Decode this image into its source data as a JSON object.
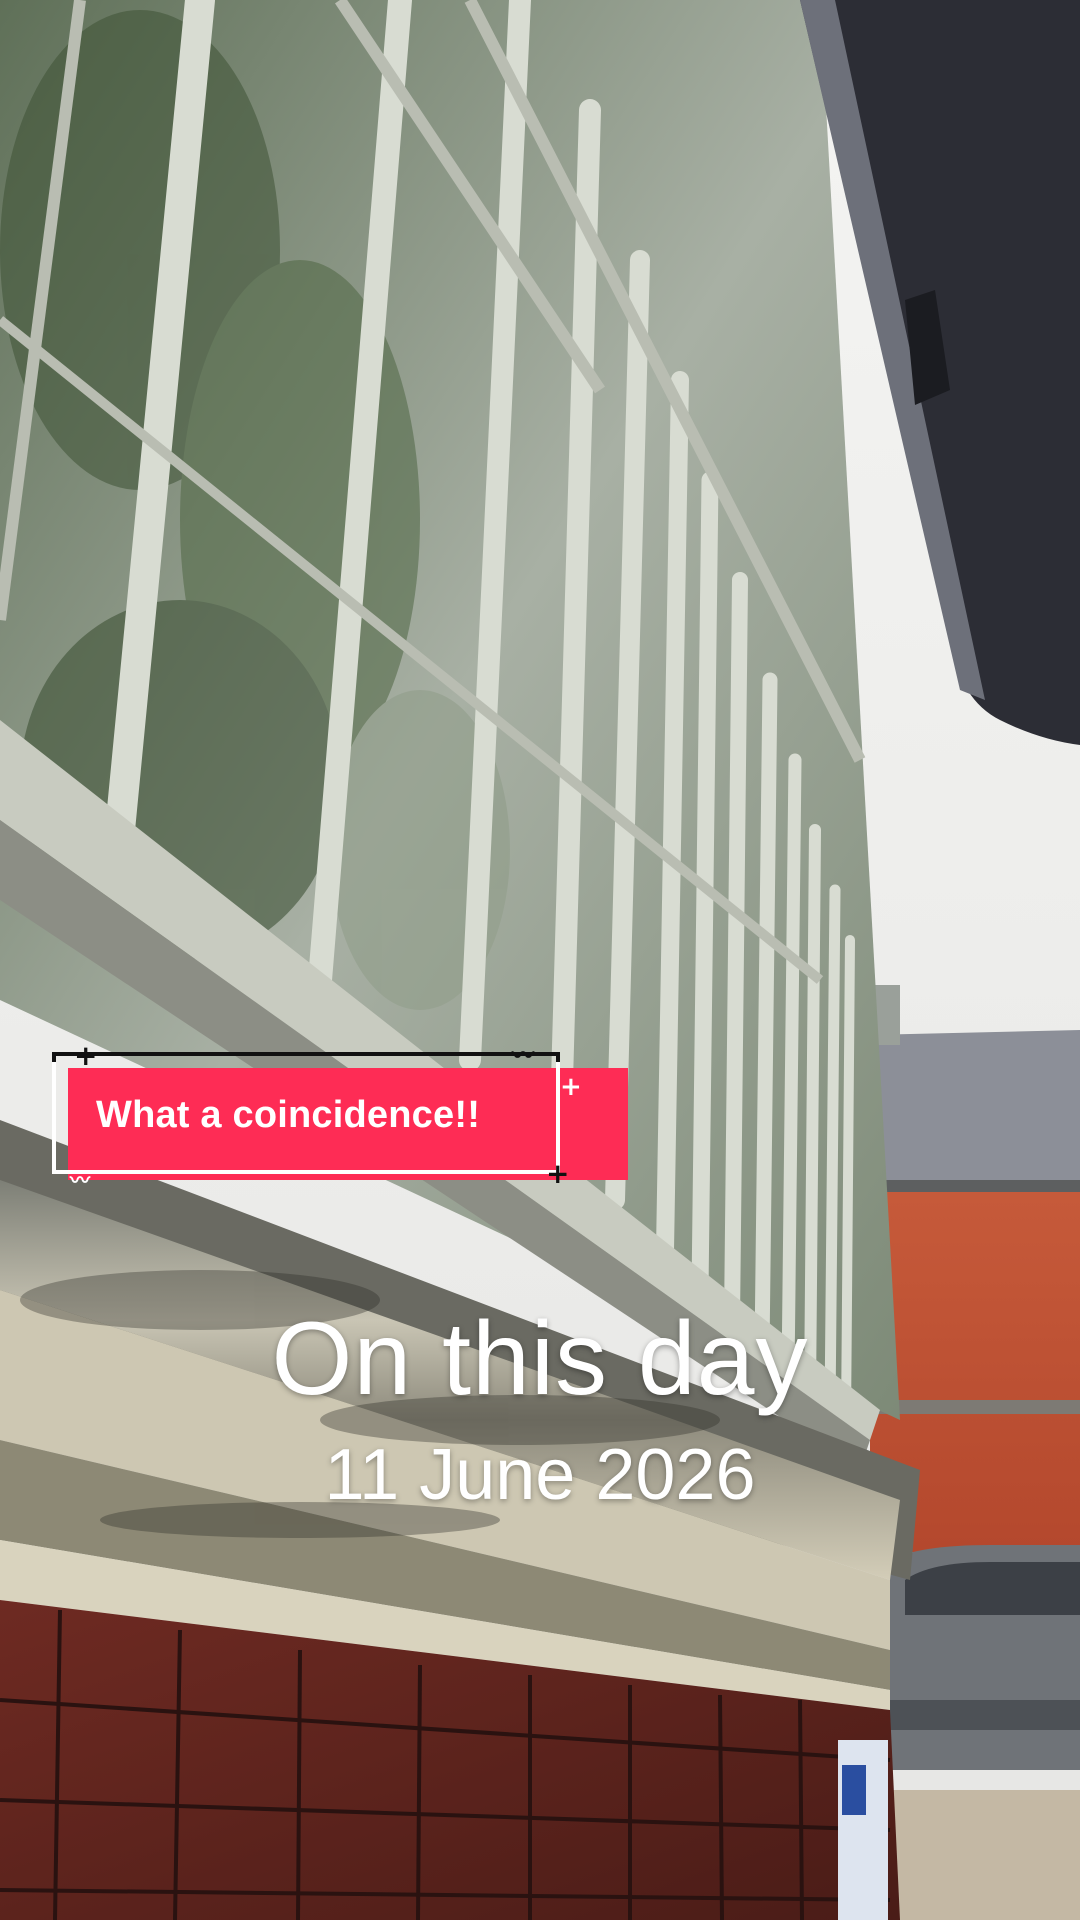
{
  "sticker": {
    "text": "What a coincidence!!",
    "color": "#fe2c55"
  },
  "overlay": {
    "title": "On this day",
    "date": "11 June 2026"
  },
  "scene": {
    "description_icon": "photo-background"
  }
}
